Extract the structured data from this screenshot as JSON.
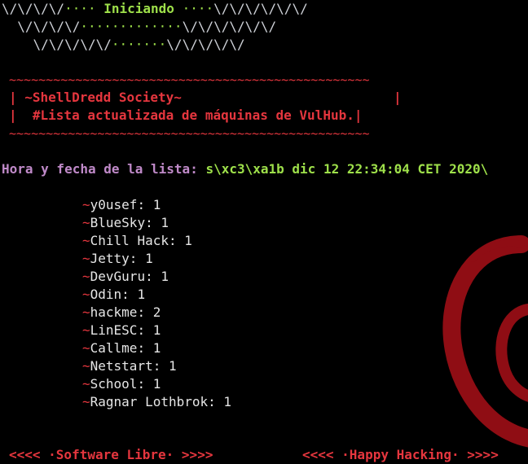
{
  "colors": {
    "background": "#000000",
    "banner_gray": "#cfd2d8",
    "banner_green": "#9ee04a",
    "society_red": "#e5363e",
    "purple": "#c08ac9",
    "list_white": "#e6e6e6",
    "swirl_red": "#8f0d14"
  },
  "banner": {
    "line1": {
      "slashes_left": "\\/\\/\\/\\/",
      "dots_left": "···· ",
      "word": "Iniciando",
      "dots_right": " ····",
      "slashes_right": "\\/\\/\\/\\/\\/\\/"
    },
    "line2": {
      "slashes_left": "  \\/\\/\\/\\/",
      "dots": "·············",
      "slashes_right": "\\/\\/\\/\\/\\/\\/"
    },
    "line3": {
      "slashes_left": "    \\/\\/\\/\\/\\/",
      "dots": "·······",
      "slashes_right": "\\/\\/\\/\\/\\/"
    }
  },
  "society_box": {
    "top_border": "~~~~~~~~~~~~~~~~~~~~~~~~~~~~~~~~~~~~~~~~~~~~~~~~~",
    "title_line": "| ~ShellDredd Society~                           |",
    "subtitle_line": "|  #Lista actualizada de máquinas de VulHub.|",
    "bottom_border": "~~~~~~~~~~~~~~~~~~~~~~~~~~~~~~~~~~~~~~~~~~~~~~~~~"
  },
  "timestamp": {
    "label": "Hora y fecha de la lista: ",
    "value": "s\\xc3\\xa1b dic 12 22:34:04 CET 2020\\"
  },
  "machines": [
    {
      "prefix": "~",
      "text": "y0usef: 1"
    },
    {
      "prefix": "~",
      "text": "BlueSky: 1"
    },
    {
      "prefix": "~",
      "text": "Chill Hack: 1"
    },
    {
      "prefix": "~",
      "text": "Jetty: 1"
    },
    {
      "prefix": "~",
      "text": "DevGuru: 1"
    },
    {
      "prefix": "~",
      "text": "Odin: 1"
    },
    {
      "prefix": "~",
      "text": "hackme: 2"
    },
    {
      "prefix": "~",
      "text": "LinESC: 1"
    },
    {
      "prefix": "~",
      "text": "Callme: 1"
    },
    {
      "prefix": "~",
      "text": "Netstart: 1"
    },
    {
      "prefix": "~",
      "text": "School: 1"
    },
    {
      "prefix": "~",
      "text": "Ragnar Lothbrok: 1"
    }
  ],
  "footer": {
    "left": "<<<< ·Software Libre· >>>>",
    "right": "<<<< ·Happy Hacking· >>>>"
  },
  "background_logo": "debian-swirl-icon"
}
